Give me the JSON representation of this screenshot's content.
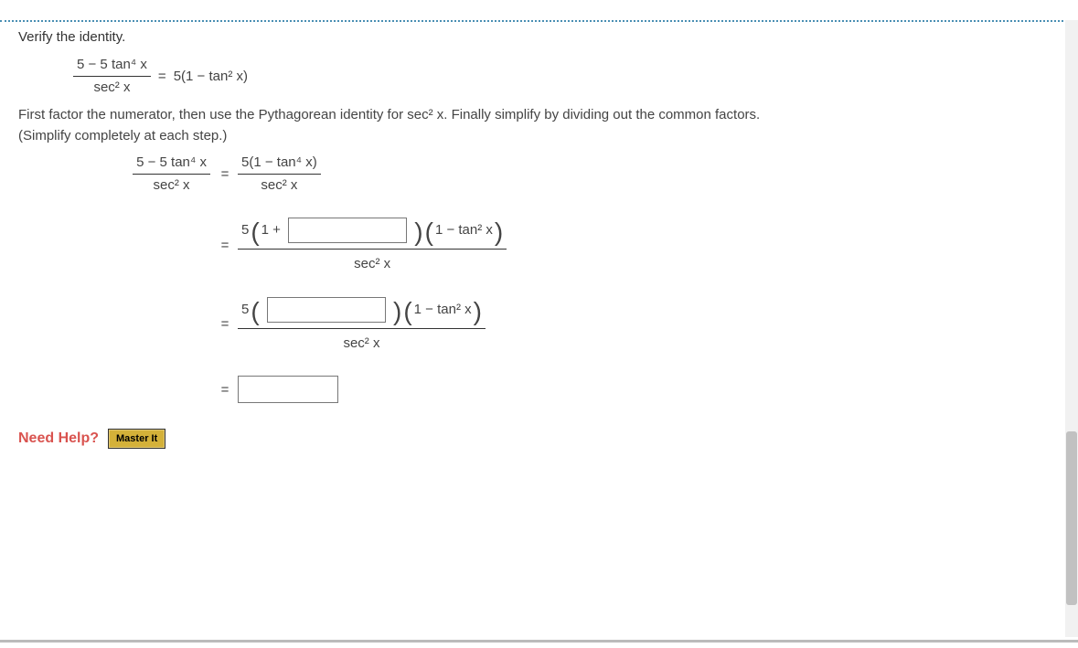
{
  "prompt": "Verify the identity.",
  "identity": {
    "lhs_num": "5 − 5 tan⁴ x",
    "lhs_den": "sec² x",
    "eq": "=",
    "rhs": "5(1 − tan² x)"
  },
  "instructions_a": "First factor the numerator, then use the Pythagorean identity for  sec² x.  Finally simplify by dividing out the common factors.",
  "instructions_b": "(Simplify completely at each step.)",
  "steps": {
    "s1": {
      "lhs_num": "5 − 5 tan⁴ x",
      "lhs_den": "sec² x",
      "rhs_num": "5(1 − tan⁴ x)",
      "rhs_den": "sec² x"
    },
    "s2": {
      "pre": "5",
      "open": "(",
      "mid": "1 +",
      "close": ")",
      "tail_open": "(",
      "tail": "1 − tan² x",
      "tail_close": ")",
      "den": "sec² x"
    },
    "s3": {
      "pre": "5",
      "open": "(",
      "close": ")",
      "tail_open": "(",
      "tail": "1 − tan² x",
      "tail_close": ")",
      "den": "sec² x"
    }
  },
  "eq": "=",
  "help_label": "Need Help?",
  "master_label": "Master It"
}
